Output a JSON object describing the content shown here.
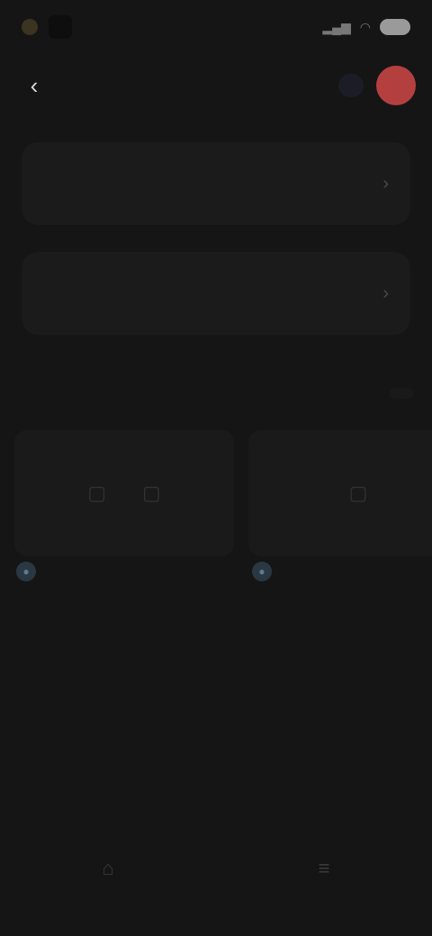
{
  "status_bar": {
    "time": "",
    "battery": ""
  },
  "top_bar": {
    "back_glyph": "‹",
    "chip_label": "",
    "avatar_initial": ""
  },
  "cards": [
    {
      "title": "",
      "subtitle": ""
    },
    {
      "title": "",
      "subtitle": ""
    }
  ],
  "section": {
    "title": "",
    "action": ""
  },
  "info": {
    "title": "",
    "line": ""
  },
  "center_link": "",
  "colors": {
    "background": "#151515",
    "card": "#1b1b1b",
    "accent_avatar": "#b3403f",
    "chip_text": "#4a5a86",
    "tile_dot": "#2a3844"
  },
  "icons": {
    "back": "chevron-left-icon",
    "card_action": "chevron-right-icon",
    "tile_left": "image-icon",
    "tile_right": "image-icon",
    "nav_left": "home-icon",
    "nav_right": "menu-icon"
  }
}
